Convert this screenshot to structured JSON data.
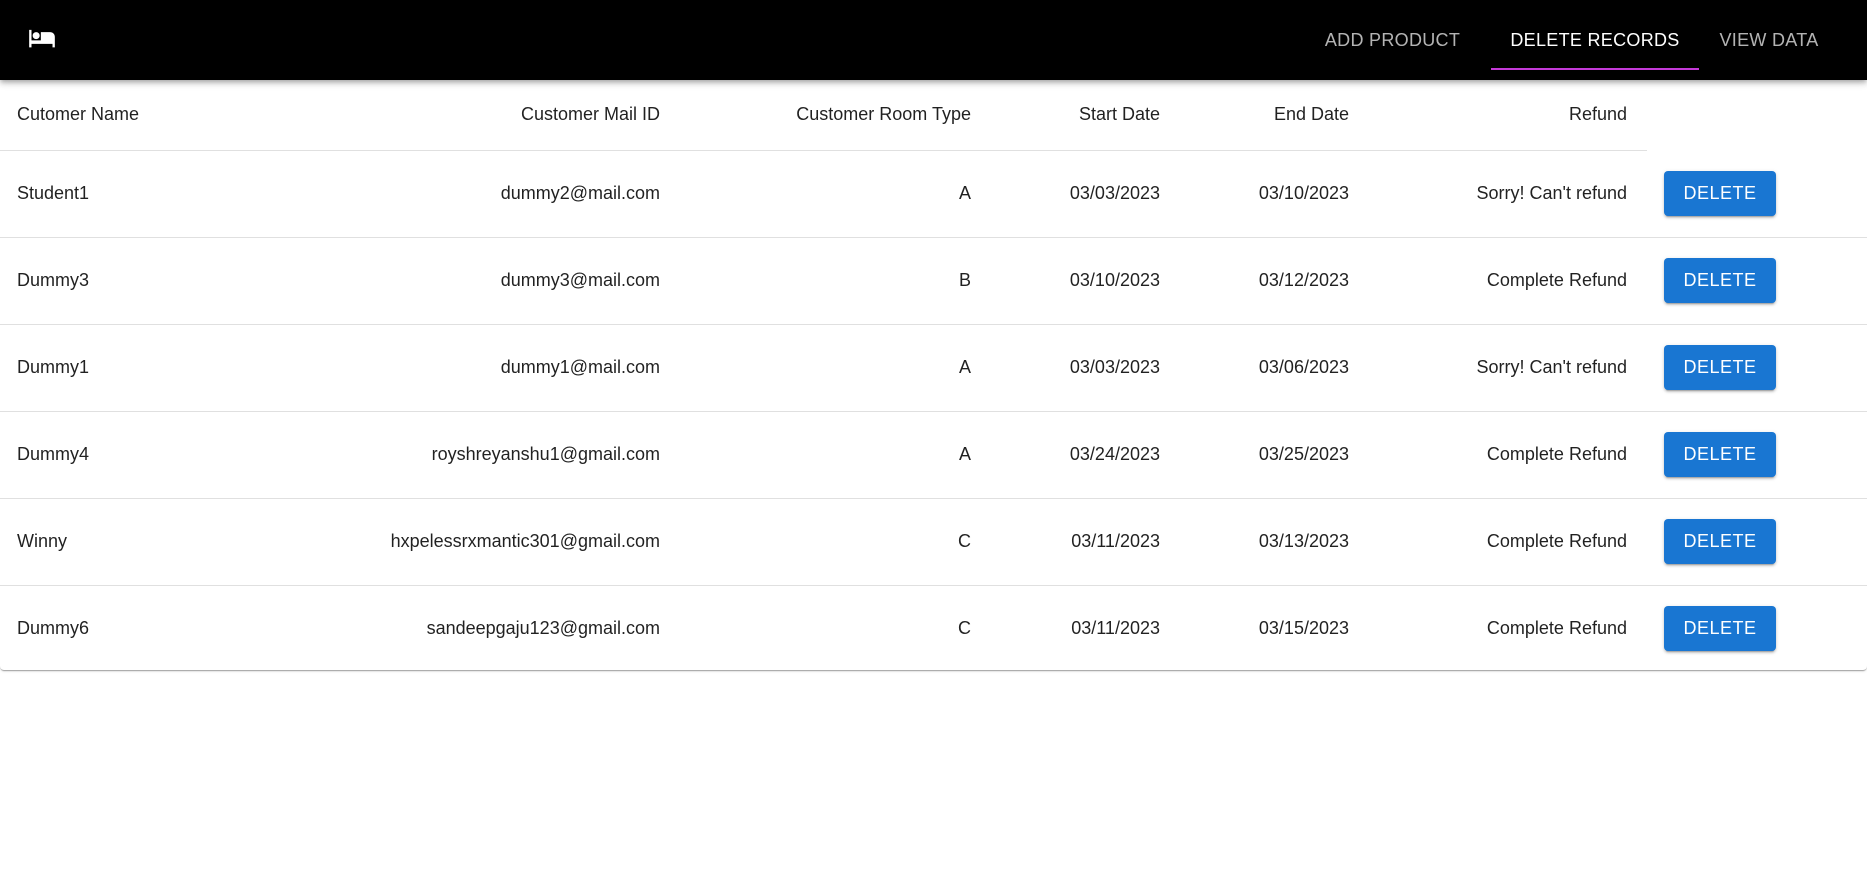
{
  "appbar": {
    "logo_icon": "hotel-bed-icon",
    "tabs": [
      {
        "label": "ADD PRODUCT",
        "active": false
      },
      {
        "label": "DELETE RECORDS",
        "active": true
      },
      {
        "label": "VIEW DATA",
        "active": false
      }
    ],
    "indicator_color": "#c53ad8"
  },
  "table": {
    "headers": [
      "Cutomer Name",
      "Customer Mail ID",
      "Customer Room Type",
      "Start Date",
      "End Date",
      "Refund"
    ],
    "delete_label": "DELETE",
    "button_color": "#1976d2",
    "rows": [
      {
        "name": "Student1",
        "email": "dummy2@mail.com",
        "room": "A",
        "start": "03/03/2023",
        "end": "03/10/2023",
        "refund": "Sorry! Can't refund"
      },
      {
        "name": "Dummy3",
        "email": "dummy3@mail.com",
        "room": "B",
        "start": "03/10/2023",
        "end": "03/12/2023",
        "refund": "Complete Refund"
      },
      {
        "name": "Dummy1",
        "email": "dummy1@mail.com",
        "room": "A",
        "start": "03/03/2023",
        "end": "03/06/2023",
        "refund": "Sorry! Can't refund"
      },
      {
        "name": "Dummy4",
        "email": "royshreyanshu1@gmail.com",
        "room": "A",
        "start": "03/24/2023",
        "end": "03/25/2023",
        "refund": "Complete Refund"
      },
      {
        "name": "Winny",
        "email": "hxpelessrxmantic301@gmail.com",
        "room": "C",
        "start": "03/11/2023",
        "end": "03/13/2023",
        "refund": "Complete Refund"
      },
      {
        "name": "Dummy6",
        "email": "sandeepgaju123@gmail.com",
        "room": "C",
        "start": "03/11/2023",
        "end": "03/15/2023",
        "refund": "Complete Refund"
      }
    ]
  }
}
